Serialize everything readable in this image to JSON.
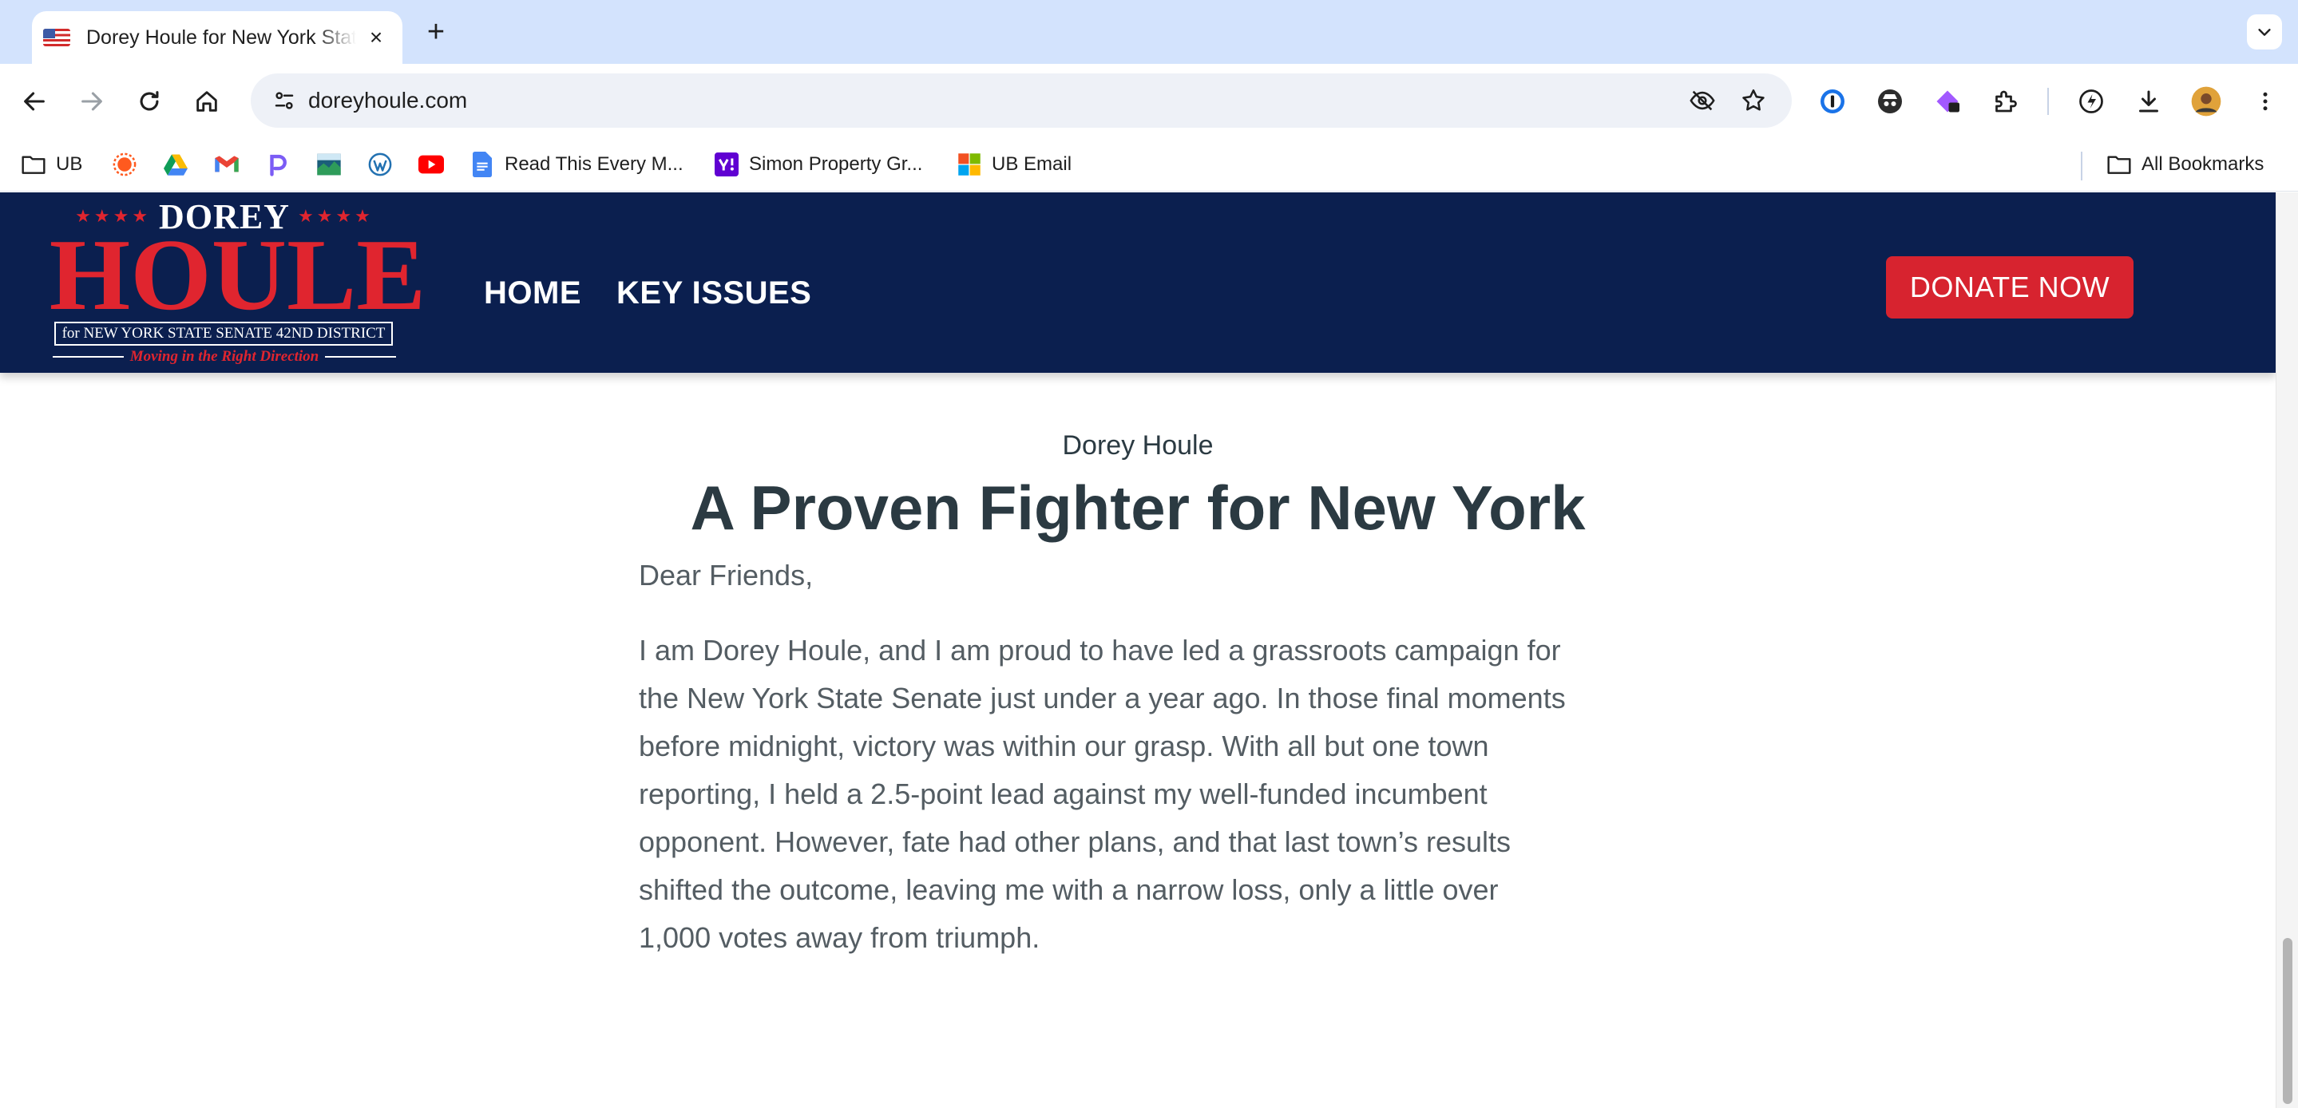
{
  "browser": {
    "tab": {
      "title": "Dorey Houle for New York State Senate"
    },
    "address": {
      "url": "doreyhoule.com"
    },
    "bookmarks": [
      {
        "label": "UB",
        "icon": "folder-icon"
      },
      {
        "label": "",
        "icon": "orange-sun-icon"
      },
      {
        "label": "",
        "icon": "google-drive-icon"
      },
      {
        "label": "",
        "icon": "gmail-icon"
      },
      {
        "label": "",
        "icon": "p-app-icon"
      },
      {
        "label": "",
        "icon": "landscape-image-icon"
      },
      {
        "label": "",
        "icon": "wordpress-icon"
      },
      {
        "label": "",
        "icon": "youtube-icon"
      },
      {
        "label": "Read This Every M...",
        "icon": "google-docs-icon"
      },
      {
        "label": "Simon Property Gr...",
        "icon": "yahoo-icon"
      },
      {
        "label": "UB Email",
        "icon": "microsoft-icon"
      }
    ],
    "all_bookmarks": "All Bookmarks"
  },
  "site": {
    "logo": {
      "first": "DOREY",
      "stars": "★★★★",
      "last": "HOULE",
      "office": "for NEW YORK STATE SENATE 42ND DISTRICT",
      "tagline": "Moving in the Right Direction"
    },
    "nav": [
      "HOME",
      "KEY ISSUES"
    ],
    "donate": "DONATE NOW"
  },
  "content": {
    "kicker": "Dorey Houle",
    "headline": "A Proven Fighter for New York",
    "salutation": "Dear Friends,",
    "lines": [
      "I am Dorey Houle, and I am proud to have led a grassroots campaign for",
      "the New York State Senate just under a year ago. In those final moments",
      "before midnight, victory was within our grasp. With all but one town",
      "reporting, I held a 2.5-point lead against my well-funded incumbent",
      "opponent. However, fate had other plans, and that last town’s results",
      "shifted the outcome, leaving me with a narrow loss, only a little over",
      "1,000 votes away from triumph."
    ]
  },
  "colors": {
    "header_navy": "#0b1f4f",
    "accent_red": "#d7232f",
    "heading_text": "#2b3a42",
    "body_text": "#545d63"
  }
}
